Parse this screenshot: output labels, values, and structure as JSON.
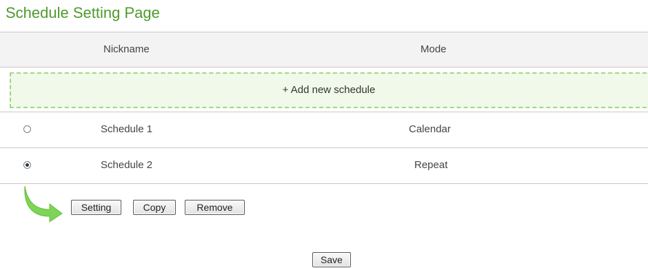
{
  "page": {
    "title": "Schedule Setting Page"
  },
  "table": {
    "headers": {
      "nickname": "Nickname",
      "mode": "Mode"
    },
    "add_label": "+ Add new schedule",
    "rows": [
      {
        "nickname": "Schedule 1",
        "mode": "Calendar",
        "selected": false
      },
      {
        "nickname": "Schedule 2",
        "mode": "Repeat",
        "selected": true
      }
    ]
  },
  "actions": {
    "setting_label": "Setting",
    "copy_label": "Copy",
    "remove_label": "Remove",
    "save_label": "Save"
  },
  "colors": {
    "title": "#4d9a2c",
    "add_border": "#9fd880",
    "add_background": "#f1f9ea",
    "arrow": "#7ed456"
  },
  "icons": {
    "action_pointer": "curved-arrow-icon"
  }
}
